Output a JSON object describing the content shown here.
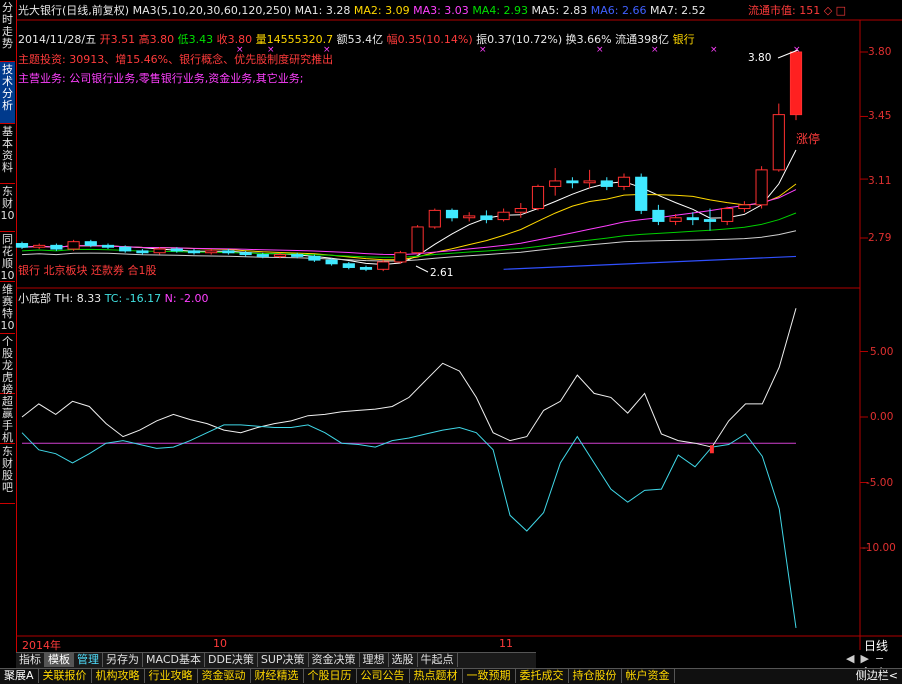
{
  "sidebar": {
    "tabs": [
      "分时走势",
      "技术分析",
      "基本资料",
      "东财10",
      "同花顺10",
      "维赛特10",
      "个股龙虎榜",
      "超赢手机",
      "东财股吧"
    ],
    "active_index": 1
  },
  "header": {
    "title": "光大银行(日线,前复权)",
    "ma_label": "MA3(5,10,20,30,60,120,250)",
    "ma1": "MA1: 3.28",
    "ma2": "MA2: 3.09",
    "ma3": "MA3: 3.03",
    "ma4": "MA4: 2.93",
    "ma5": "MA5: 2.83",
    "ma6": "MA6: 2.66",
    "ma7": "MA7: 2.52",
    "float_mv": "流通市值: 151",
    "float_mv_icon": "◇",
    "close_icon": "□",
    "date": "2014/11/28/五",
    "open": "开3.51",
    "high": "高3.80",
    "low": "低3.43",
    "close": "收3.80",
    "volume": "量14555320.7",
    "amount": "额53.4亿",
    "change": "幅0.35(10.14%)",
    "amplitude": "振0.37(10.72%)",
    "turnover": "换3.66%",
    "float_shares": "流通398亿",
    "sector": "银行",
    "theme": "主题投资: 30913、增15.46%、银行概念、优先股制度研究推出",
    "business": "主营业务: 公司银行业务,零售银行业务,资金业务,其它业务;",
    "annotation": "银行 北京板块 还款券 合1股"
  },
  "main_chart": {
    "price_ticks": [
      "3.80",
      "3.45",
      "3.11",
      "2.79"
    ],
    "max_label": "3.80",
    "min_label": "2.61",
    "limit_up_label": "涨停",
    "candles": [
      [
        2.76,
        2.77,
        2.73,
        2.74
      ],
      [
        2.74,
        2.76,
        2.73,
        2.75
      ],
      [
        2.75,
        2.76,
        2.72,
        2.73
      ],
      [
        2.73,
        2.78,
        2.72,
        2.77
      ],
      [
        2.77,
        2.78,
        2.74,
        2.75
      ],
      [
        2.75,
        2.76,
        2.73,
        2.74
      ],
      [
        2.74,
        2.75,
        2.71,
        2.72
      ],
      [
        2.72,
        2.73,
        2.7,
        2.71
      ],
      [
        2.71,
        2.74,
        2.7,
        2.73
      ],
      [
        2.73,
        2.74,
        2.71,
        2.72
      ],
      [
        2.72,
        2.73,
        2.7,
        2.71
      ],
      [
        2.71,
        2.73,
        2.7,
        2.72
      ],
      [
        2.72,
        2.73,
        2.7,
        2.71
      ],
      [
        2.71,
        2.72,
        2.69,
        2.7
      ],
      [
        2.7,
        2.71,
        2.68,
        2.69
      ],
      [
        2.69,
        2.71,
        2.68,
        2.7
      ],
      [
        2.7,
        2.71,
        2.68,
        2.69
      ],
      [
        2.69,
        2.7,
        2.66,
        2.67
      ],
      [
        2.67,
        2.68,
        2.64,
        2.65
      ],
      [
        2.65,
        2.66,
        2.62,
        2.63
      ],
      [
        2.63,
        2.64,
        2.61,
        2.62
      ],
      [
        2.62,
        2.67,
        2.61,
        2.66
      ],
      [
        2.66,
        2.72,
        2.65,
        2.71
      ],
      [
        2.71,
        2.86,
        2.7,
        2.85
      ],
      [
        2.85,
        2.95,
        2.84,
        2.94
      ],
      [
        2.94,
        2.95,
        2.88,
        2.9
      ],
      [
        2.9,
        2.93,
        2.88,
        2.91
      ],
      [
        2.91,
        2.94,
        2.87,
        2.89
      ],
      [
        2.89,
        2.95,
        2.88,
        2.93
      ],
      [
        2.93,
        2.98,
        2.9,
        2.95
      ],
      [
        2.95,
        3.08,
        2.94,
        3.07
      ],
      [
        3.07,
        3.17,
        3.02,
        3.1
      ],
      [
        3.1,
        3.12,
        3.06,
        3.09
      ],
      [
        3.09,
        3.16,
        3.06,
        3.1
      ],
      [
        3.1,
        3.12,
        3.05,
        3.07
      ],
      [
        3.07,
        3.14,
        3.05,
        3.12
      ],
      [
        3.12,
        3.14,
        2.92,
        2.94
      ],
      [
        2.94,
        2.97,
        2.86,
        2.88
      ],
      [
        2.88,
        2.92,
        2.86,
        2.9
      ],
      [
        2.9,
        2.93,
        2.86,
        2.89
      ],
      [
        2.89,
        2.95,
        2.83,
        2.88
      ],
      [
        2.88,
        2.96,
        2.86,
        2.95
      ],
      [
        2.95,
        2.99,
        2.93,
        2.97
      ],
      [
        2.97,
        3.18,
        2.95,
        3.16
      ],
      [
        3.16,
        3.52,
        3.15,
        3.46
      ],
      [
        3.46,
        3.8,
        3.43,
        3.8
      ]
    ]
  },
  "indicator": {
    "name": "小底部",
    "th": "TH: 8.33",
    "tc": "TC: -16.17",
    "n": "N: -2.00",
    "ticks": [
      "5.00",
      "0.00",
      "-5.00",
      "-10.00"
    ]
  },
  "time_axis": {
    "labels": [
      "2014年",
      "10",
      "11"
    ],
    "period": "日线"
  },
  "bottom_tabs": [
    "指标",
    "模板",
    "管理",
    "另存为",
    "MACD基本",
    "DDE决策",
    "SUP决策",
    "资金决策",
    "理想",
    "选股",
    "牛起点"
  ],
  "bottom_tab_selected": 1,
  "bottom_tab_highlight": 2,
  "bottom_bar2": [
    "聚展A",
    "关联报价",
    "机构攻略",
    "行业攻略",
    "资金驱动",
    "财经精选",
    "个股日历",
    "公司公告",
    "热点题材",
    "一致预期",
    "委托成交",
    "持仓股份",
    "帐户资金"
  ],
  "bottom_right": "侧边栏<",
  "nav_icons": {
    "prev": "◀",
    "next": "▶",
    "minus": "−",
    "plus": "+",
    "up": "↑",
    "down": "↓"
  }
}
